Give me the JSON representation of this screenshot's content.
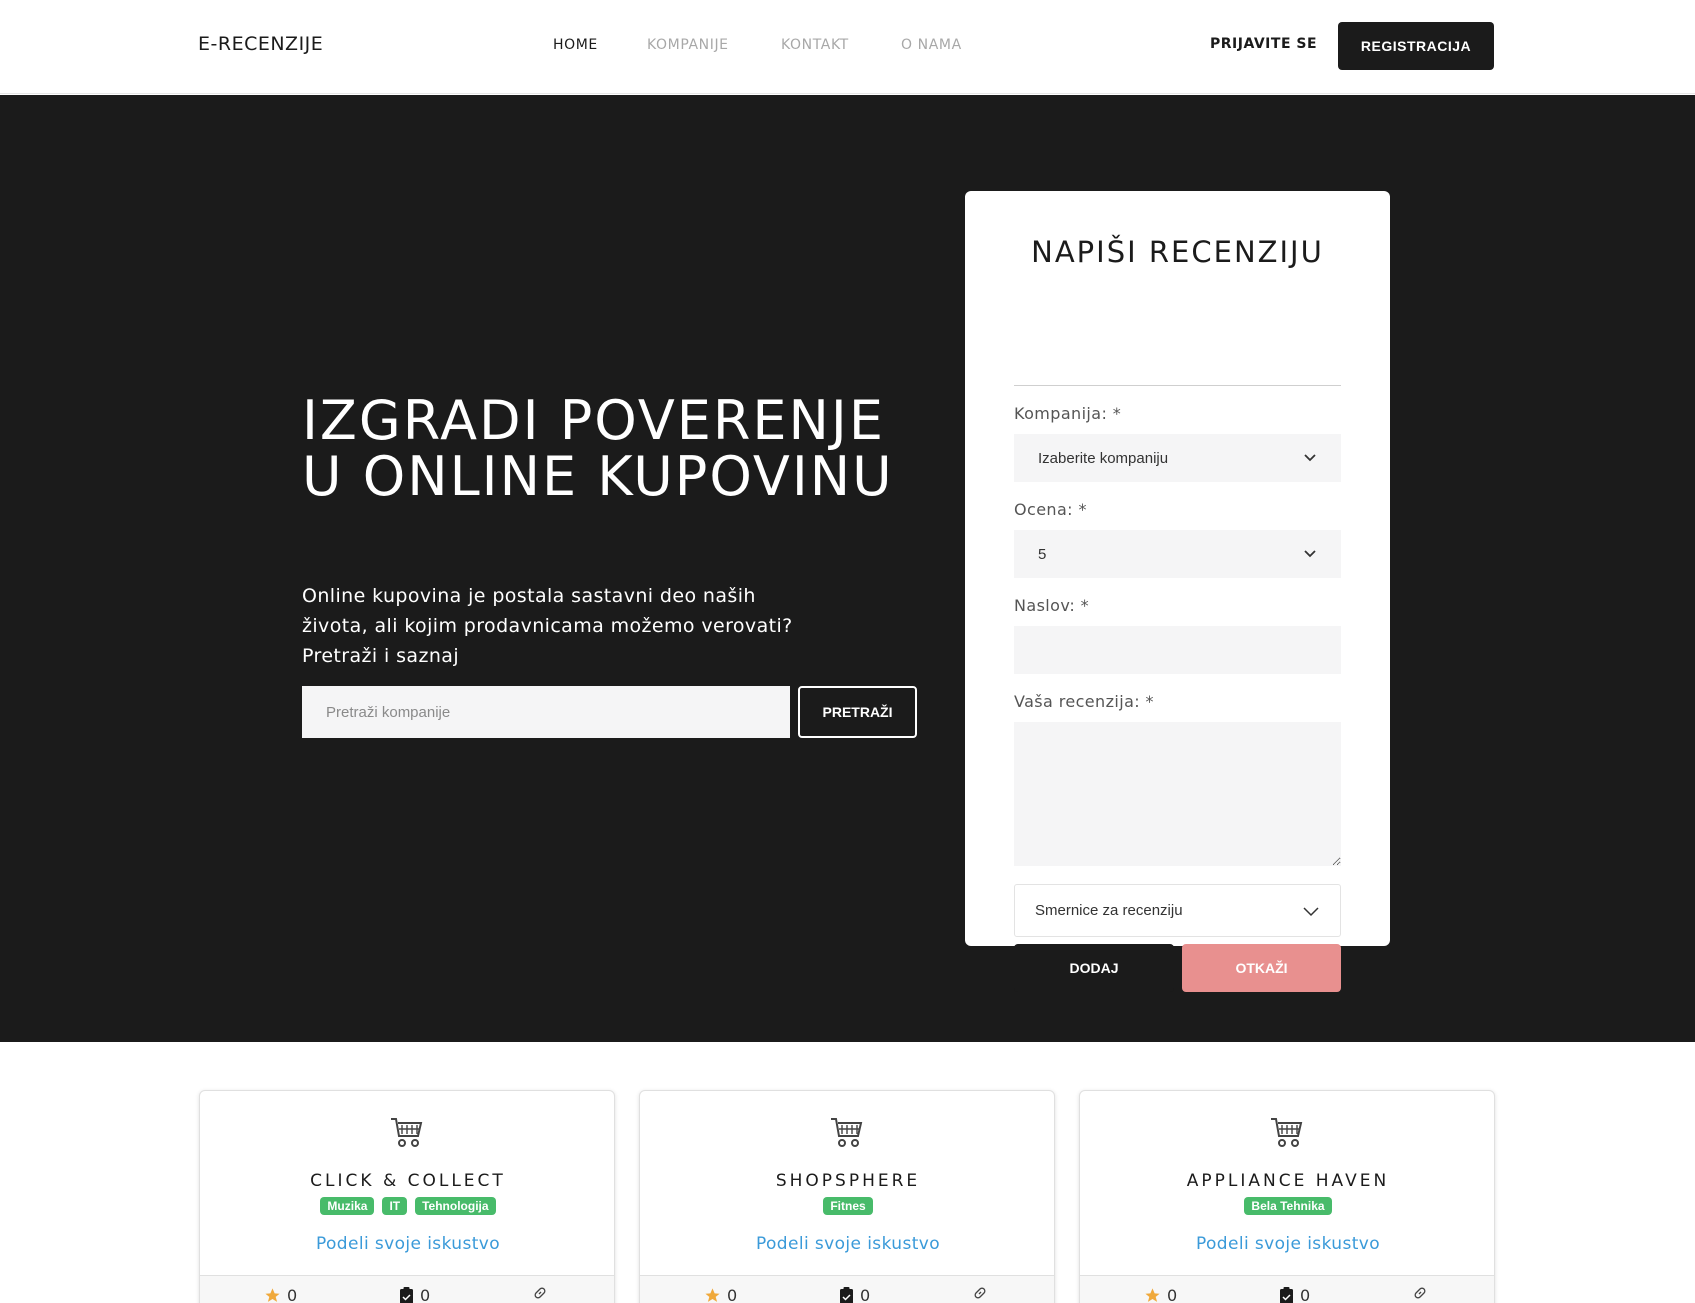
{
  "navbar": {
    "brand": "E-RECENZIJE",
    "links": [
      "HOME",
      "KOMPANIJE",
      "KONTAKT",
      "O NAMA"
    ],
    "login": "PRIJAVITE SE",
    "register": "REGISTRACIJA"
  },
  "hero": {
    "title": "IZGRADI POVERENJE U ONLINE KUPOVINU",
    "subtitle": "Online kupovina je postala sastavni deo naših života, ali kojim prodavnicama možemo verovati? Pretraži i saznaj",
    "search_placeholder": "Pretraži kompanije",
    "search_button": "PRETRAŽI"
  },
  "review_form": {
    "title": "NAPIŠI RECENZIJU",
    "company_label": "Kompanija: *",
    "company_value": "Izaberite kompaniju",
    "rating_label": "Ocena: *",
    "rating_value": "5",
    "title_label": "Naslov: *",
    "review_label": "Vaša recenzija: *",
    "guidelines": "Smernice za recenziju",
    "add_button": "DODAJ",
    "cancel_button": "OTKAŽI"
  },
  "companies": [
    {
      "name": "CLICK & COLLECT",
      "tags": [
        "Muzika",
        "IT",
        "Tehnologija"
      ],
      "share": "Podeli svoje iskustvo",
      "rating": "0",
      "reviews": "0"
    },
    {
      "name": "SHOPSPHERE",
      "tags": [
        "Fitnes"
      ],
      "share": "Podeli svoje iskustvo",
      "rating": "0",
      "reviews": "0"
    },
    {
      "name": "APPLIANCE HAVEN",
      "tags": [
        "Bela Tehnika"
      ],
      "share": "Podeli svoje iskustvo",
      "rating": "0",
      "reviews": "0"
    }
  ],
  "colors": {
    "dark": "#1b1b1b",
    "cancel": "#e8908f",
    "tag": "#48bb6a",
    "link": "#3a9ad9",
    "star": "#f0a93b"
  },
  "icons": [
    "chevron-down-icon",
    "cart-icon",
    "star-icon",
    "clipboard-icon",
    "link-icon"
  ]
}
